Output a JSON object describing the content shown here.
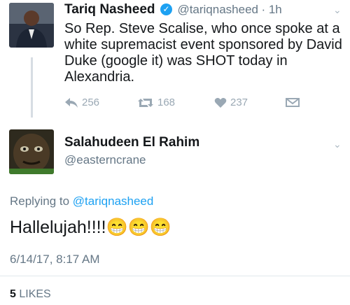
{
  "original_tweet": {
    "name": "Tariq Nasheed",
    "handle": "@tariqnasheed",
    "time": "· 1h",
    "text": "So Rep. Steve Scalise, who once spoke at a white supremacist event sponsored by David Duke (google it) was SHOT today in Alexandria.",
    "replies": "256",
    "retweets": "168",
    "likes": "237"
  },
  "reply_tweet": {
    "name": "Salahudeen El Rahim",
    "handle": "@easterncrane",
    "replying_prefix": "Replying to ",
    "replying_to": "@tariqnasheed",
    "text": "Hallelujah!!!!",
    "emoji": [
      "😁",
      "😁",
      "😁"
    ],
    "timestamp": "6/14/17, 8:17 AM",
    "likes_count": "5",
    "likes_label": "LIKES"
  },
  "icons": {
    "reply": "reply-icon",
    "retweet": "retweet-icon",
    "like": "heart-icon",
    "dm": "envelope-icon",
    "verified": "verified-icon",
    "more": "chevron-down-icon"
  },
  "colors": {
    "link": "#1da1f2",
    "secondary": "#657786",
    "action": "#9aa8b4"
  }
}
